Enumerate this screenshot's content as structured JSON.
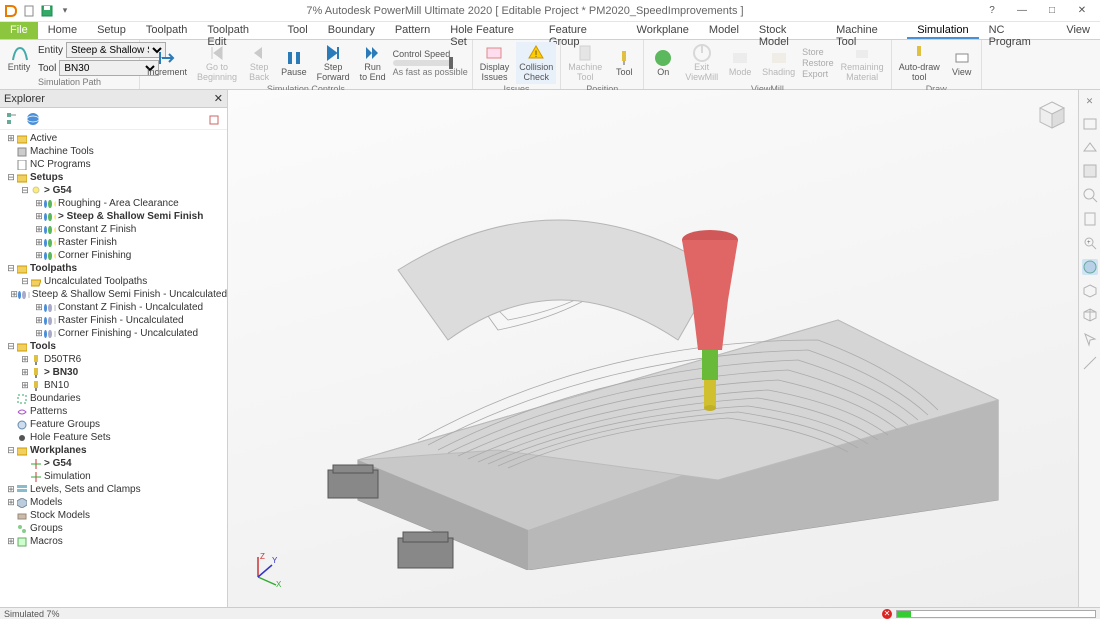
{
  "title": "7% Autodesk PowerMill Ultimate 2020     [ Editable Project * PM2020_SpeedImprovements ]",
  "tabs": [
    "File",
    "Home",
    "Setup",
    "Toolpath",
    "Toolpath Edit",
    "Tool",
    "Boundary",
    "Pattern",
    "Hole Feature Set",
    "Feature Group",
    "Workplane",
    "Model",
    "Stock Model",
    "Machine Tool",
    "Simulation",
    "NC Program",
    "View"
  ],
  "active_tab": "Simulation",
  "ribbon": {
    "entity_label": "Entity",
    "entity_value": "Steep & Shallow Semi Fi",
    "tool_label": "Tool",
    "tool_value": "BN30",
    "group_simpath": "Simulation Path",
    "increment": "Increment",
    "goto_beg": "Go to\nBeginning",
    "step_back": "Step\nBack",
    "pause": "Pause",
    "step_fwd": "Step\nForward",
    "run_end": "Run\nto End",
    "control_speed": "Control Speed",
    "asfast": "As fast as possible",
    "group_controls": "Simulation Controls",
    "display_issues": "Display\nIssues",
    "collision": "Collision\nCheck",
    "group_issues": "Issues",
    "machine_tool": "Machine\nTool",
    "tool": "Tool",
    "group_position": "Position",
    "on": "On",
    "exit_vm": "Exit\nViewMill",
    "mode": "Mode",
    "shading": "Shading",
    "store": "Store",
    "restore": "Restore",
    "export": "Export",
    "remaining": "Remaining\nMaterial",
    "group_viewmill": "ViewMill",
    "autodraw": "Auto-draw\ntool",
    "view": "View",
    "group_draw": "Draw"
  },
  "explorer": {
    "title": "Explorer",
    "tree": [
      {
        "depth": 0,
        "exp": "+",
        "icon": "folder",
        "label": "Active"
      },
      {
        "depth": 0,
        "exp": "",
        "icon": "machine",
        "label": "Machine Tools"
      },
      {
        "depth": 0,
        "exp": "",
        "icon": "nc",
        "label": "NC Programs"
      },
      {
        "depth": 0,
        "exp": "-",
        "icon": "folder",
        "label": "Setups",
        "bold": true
      },
      {
        "depth": 1,
        "exp": "-",
        "icon": "light",
        "label": "> G54",
        "bold": true
      },
      {
        "depth": 2,
        "exp": "+",
        "icon": "tp",
        "label": "Roughing - Area Clearance"
      },
      {
        "depth": 2,
        "exp": "+",
        "icon": "tp",
        "label": "> Steep & Shallow Semi Finish",
        "bold": true
      },
      {
        "depth": 2,
        "exp": "+",
        "icon": "tp",
        "label": "Constant Z Finish"
      },
      {
        "depth": 2,
        "exp": "+",
        "icon": "tp",
        "label": "Raster Finish"
      },
      {
        "depth": 2,
        "exp": "+",
        "icon": "tp",
        "label": "Corner Finishing"
      },
      {
        "depth": 0,
        "exp": "-",
        "icon": "folder",
        "label": "Toolpaths",
        "bold": true
      },
      {
        "depth": 1,
        "exp": "-",
        "icon": "folderopen",
        "label": "Uncalculated Toolpaths"
      },
      {
        "depth": 2,
        "exp": "+",
        "icon": "utp",
        "label": "Steep & Shallow Semi Finish - Uncalculated"
      },
      {
        "depth": 2,
        "exp": "+",
        "icon": "utp",
        "label": "Constant Z Finish - Uncalculated"
      },
      {
        "depth": 2,
        "exp": "+",
        "icon": "utp",
        "label": "Raster Finish - Uncalculated"
      },
      {
        "depth": 2,
        "exp": "+",
        "icon": "utp",
        "label": "Corner Finishing - Uncalculated"
      },
      {
        "depth": 0,
        "exp": "-",
        "icon": "folder",
        "label": "Tools",
        "bold": true
      },
      {
        "depth": 1,
        "exp": "+",
        "icon": "tool",
        "label": "D50TR6"
      },
      {
        "depth": 1,
        "exp": "+",
        "icon": "tool",
        "label": "> BN30",
        "bold": true
      },
      {
        "depth": 1,
        "exp": "+",
        "icon": "tool",
        "label": "BN10"
      },
      {
        "depth": 0,
        "exp": "",
        "icon": "boundary",
        "label": "Boundaries"
      },
      {
        "depth": 0,
        "exp": "",
        "icon": "pattern",
        "label": "Patterns"
      },
      {
        "depth": 0,
        "exp": "",
        "icon": "feat",
        "label": "Feature Groups"
      },
      {
        "depth": 0,
        "exp": "",
        "icon": "hole",
        "label": "Hole Feature Sets"
      },
      {
        "depth": 0,
        "exp": "-",
        "icon": "folder",
        "label": "Workplanes",
        "bold": true
      },
      {
        "depth": 1,
        "exp": "",
        "icon": "wp",
        "label": "> G54",
        "bold": true
      },
      {
        "depth": 1,
        "exp": "",
        "icon": "wp",
        "label": "Simulation"
      },
      {
        "depth": 0,
        "exp": "+",
        "icon": "levels",
        "label": "Levels, Sets and Clamps"
      },
      {
        "depth": 0,
        "exp": "+",
        "icon": "model",
        "label": "Models"
      },
      {
        "depth": 0,
        "exp": "",
        "icon": "stock",
        "label": "Stock Models"
      },
      {
        "depth": 0,
        "exp": "",
        "icon": "group",
        "label": "Groups"
      },
      {
        "depth": 0,
        "exp": "+",
        "icon": "macro",
        "label": "Macros"
      }
    ]
  },
  "axis": {
    "x": "X",
    "y": "Y",
    "z": "Z"
  },
  "status": {
    "text": "Simulated 7%",
    "progress_pct": 7
  },
  "colors": {
    "accent": "#4a90d9",
    "file_tab": "#8cc63f",
    "play_green": "#5cb85c",
    "pause_blue": "#2b7bb9",
    "tool_red": "#e06666",
    "tool_yellow": "#d0c030",
    "tool_green": "#6aba3a"
  }
}
